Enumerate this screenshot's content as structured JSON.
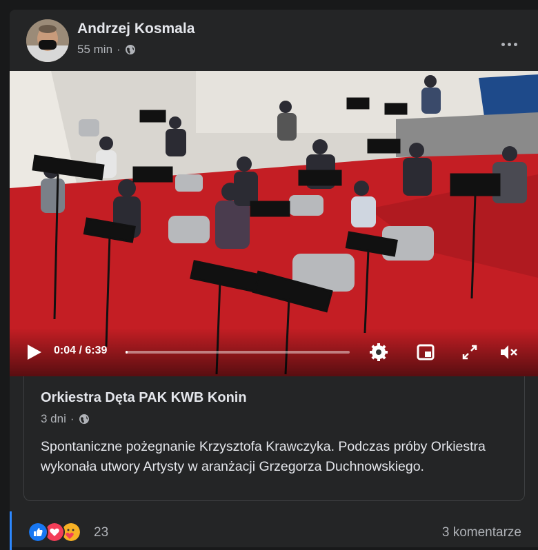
{
  "post": {
    "author": "Andrzej Kosmala",
    "time": "55 min",
    "separator": "·",
    "privacy_icon": "globe-icon",
    "more_icon": "more-horizontal-icon"
  },
  "video": {
    "current_time": "0:04",
    "duration": "6:39",
    "time_separator": " / ",
    "progress_fraction": 0.01,
    "icons": [
      "play-icon",
      "settings-icon",
      "picture-in-picture-icon",
      "fullscreen-icon",
      "volume-muted-icon"
    ]
  },
  "shared": {
    "page_name": "Orkiestra Dęta PAK KWB Konin",
    "time": "3 dni",
    "separator": "·",
    "privacy_icon": "globe-icon",
    "text": "Spontaniczne pożegnanie Krzysztofa Krawczyka. Podczas próby Orkiestra wykonała utwory Artysty w aranżacji Grzegorza Duchnowskiego."
  },
  "reactions": {
    "icons": [
      "like-icon",
      "love-icon",
      "care-icon"
    ],
    "count": "23",
    "comments": "3 komentarze"
  },
  "colors": {
    "background": "#18191a",
    "card": "#242526",
    "primary_text": "#e4e6eb",
    "secondary_text": "#b0b3b8",
    "accent": "#2d88ff",
    "like_blue": "#1877f2",
    "love_red": "#f33e58",
    "care_yellow": "#f7b125",
    "carpet_red": "#c41e24"
  }
}
